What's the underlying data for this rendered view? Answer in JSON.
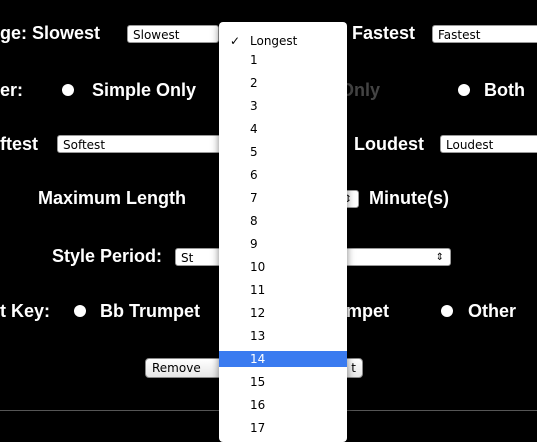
{
  "row1": {
    "label_left": "ge: Slowest",
    "select_left": "Slowest",
    "label_right": "Fastest",
    "select_right": "Fastest"
  },
  "row2": {
    "label": "er:",
    "opt1": "Simple Only",
    "opt2": "Compound Only",
    "opt3": "Both"
  },
  "row3": {
    "label_left": "ftest",
    "select_left": "Softest",
    "label_right": "Loudest",
    "select_right": "Loudest"
  },
  "row4": {
    "label": "Maximum Length",
    "select": "",
    "unit": "Minute(s)"
  },
  "row5": {
    "label": "Style Period:",
    "select": "St"
  },
  "row6": {
    "label": "t Key:",
    "opt1": "Bb Trumpet",
    "opt2": "C Trumpet",
    "opt3": "Other"
  },
  "buttons": {
    "remove": "Remove",
    "other": "t"
  },
  "dropdown": {
    "checked_item": "Longest",
    "highlighted_item": "14",
    "items": [
      "Longest",
      "1",
      "2",
      "3",
      "4",
      "5",
      "6",
      "7",
      "8",
      "9",
      "10",
      "11",
      "12",
      "13",
      "14",
      "15",
      "16",
      "17"
    ]
  },
  "colors": {
    "background": "#000000",
    "highlight": "#3a7bf0"
  }
}
